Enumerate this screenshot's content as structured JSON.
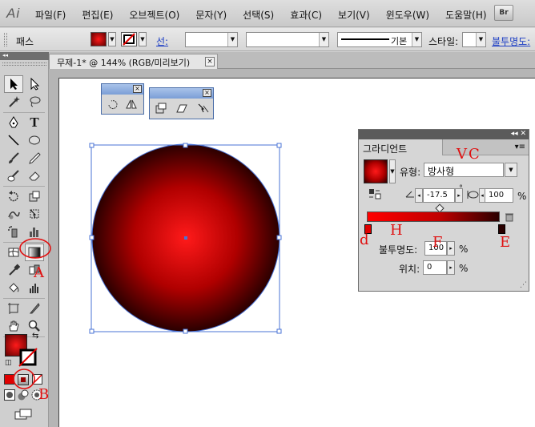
{
  "app": {
    "logo": "Ai",
    "bridge_button": "Br"
  },
  "menu": [
    "파일(F)",
    "편집(E)",
    "오브젝트(O)",
    "문자(Y)",
    "선택(S)",
    "효과(C)",
    "보기(V)",
    "윈도우(W)",
    "도움말(H)"
  ],
  "control_bar": {
    "path_label": "패스",
    "stroke_label": "선:",
    "stroke_style": "기본",
    "style_label": "스타일:",
    "opacity_label": "불투명도:"
  },
  "document_tab": {
    "title": "무제-1* @ 144% (RGB/미리보기)",
    "close": "×"
  },
  "gradient_panel": {
    "tab": "그라디언트",
    "type_label": "유형:",
    "type_value": "방사형",
    "angle_value": "-17.5",
    "angle_unit": "°",
    "aspect_value": "100",
    "aspect_unit": "%",
    "opacity_label": "불투명도:",
    "opacity_value": "100",
    "opacity_unit": "%",
    "location_label": "위치:",
    "location_value": "0",
    "location_unit": "%",
    "colors": {
      "start": "#ff1a1a",
      "mid": "#b00000",
      "end": "#2a0000"
    }
  },
  "annotations": [
    "VC",
    "A",
    "B",
    "d",
    "H",
    "F",
    "E"
  ],
  "colors": {
    "fill": "#e00000",
    "selection": "#4a73d6",
    "panel_title": "#5b5b5b"
  }
}
